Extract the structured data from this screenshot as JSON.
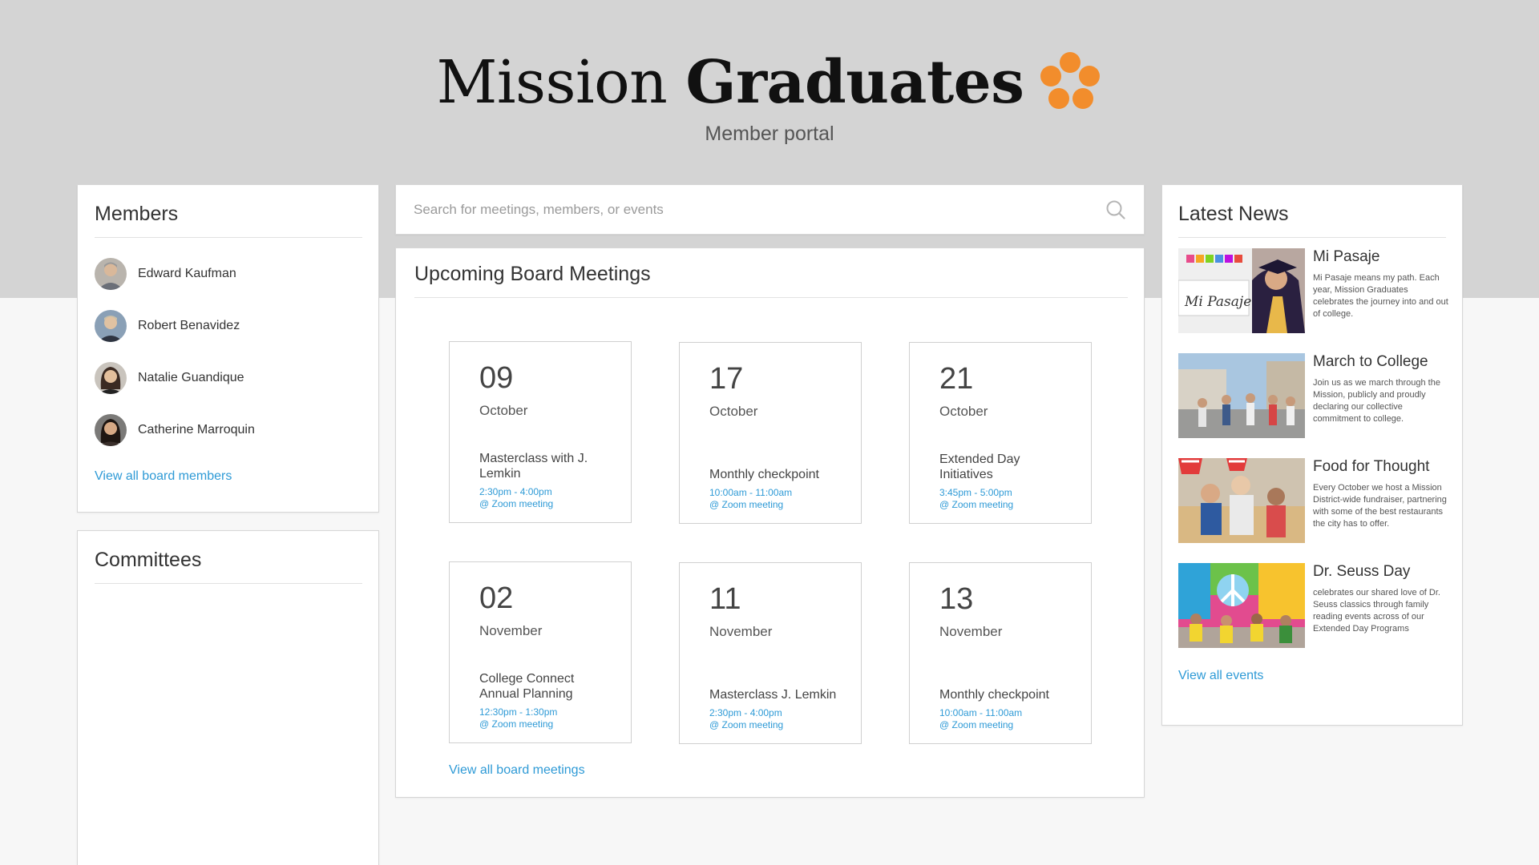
{
  "header": {
    "logo_word1": "Mission",
    "logo_word2": "Graduates",
    "subtitle": "Member portal",
    "brand_color": "#f28d2c"
  },
  "members": {
    "title": "Members",
    "items": [
      {
        "name": "Edward Kaufman"
      },
      {
        "name": "Robert Benavidez"
      },
      {
        "name": "Natalie Guandique"
      },
      {
        "name": "Catherine Marroquin"
      }
    ],
    "view_all": "View all board members"
  },
  "committees": {
    "title": "Committees"
  },
  "search": {
    "placeholder": "Search for meetings, members, or events",
    "icon": "search-icon"
  },
  "meetings": {
    "title": "Upcoming Board Meetings",
    "items": [
      {
        "day": "09",
        "month": "October",
        "title": "Masterclass with J. Lemkin",
        "time": "2:30pm - 4:00pm",
        "location": "@ Zoom meeting"
      },
      {
        "day": "17",
        "month": "October",
        "title": "Monthly checkpoint",
        "time": "10:00am - 11:00am",
        "location": "@ Zoom meeting"
      },
      {
        "day": "21",
        "month": "October",
        "title": "Extended Day Initiatives",
        "time": "3:45pm - 5:00pm",
        "location": "@ Zoom meeting"
      },
      {
        "day": "02",
        "month": "November",
        "title": "College Connect Annual Planning",
        "time": "12:30pm - 1:30pm",
        "location": "@ Zoom meeting"
      },
      {
        "day": "11",
        "month": "November",
        "title": "Masterclass J. Lemkin",
        "time": "2:30pm - 4:00pm",
        "location": "@ Zoom meeting"
      },
      {
        "day": "13",
        "month": "November",
        "title": "Monthly checkpoint",
        "time": "10:00am - 11:00am",
        "location": "@ Zoom meeting"
      }
    ],
    "view_all": "View all board meetings"
  },
  "news": {
    "title": "Latest News",
    "items": [
      {
        "title": "Mi Pasaje",
        "desc": "Mi Pasaje means my path. Each year, Mission Graduates celebrates the journey into and out of college.",
        "image_sign": "Mi Pasaje"
      },
      {
        "title": "March to College",
        "desc": "Join us as we march through the Mission, publicly and proudly declaring our collective commitment to college."
      },
      {
        "title": "Food for Thought",
        "desc": "Every October we host a Mission District-wide fundraiser, partnering with some of the best restaurants the city has to offer."
      },
      {
        "title": "Dr. Seuss Day",
        "desc": "celebrates our shared love of Dr. Seuss classics through family reading events across of our Extended Day Programs"
      }
    ],
    "view_all": "View all events"
  }
}
